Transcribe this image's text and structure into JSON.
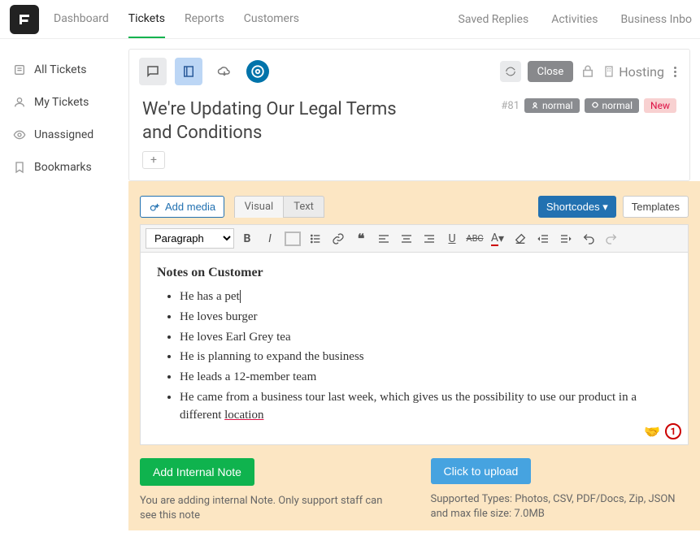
{
  "topnav": [
    "Dashboard",
    "Tickets",
    "Reports",
    "Customers"
  ],
  "topnav_active": 1,
  "rightnav": [
    "Saved Replies",
    "Activities",
    "Business Inbo"
  ],
  "sidebar": [
    {
      "label": "All Tickets",
      "icon": "list"
    },
    {
      "label": "My Tickets",
      "icon": "user"
    },
    {
      "label": "Unassigned",
      "icon": "eye"
    },
    {
      "label": "Bookmarks",
      "icon": "bookmark"
    }
  ],
  "panel": {
    "close_label": "Close",
    "hosting_label": "Hosting"
  },
  "ticket": {
    "title": "We're Updating Our Legal Terms and Conditions",
    "id": "#81",
    "badges": [
      {
        "label": "normal",
        "kind": "grey"
      },
      {
        "label": "normal",
        "kind": "grey"
      },
      {
        "label": "New",
        "kind": "red"
      }
    ]
  },
  "editor": {
    "add_media": "Add media",
    "tabs": {
      "visual": "Visual",
      "text": "Text"
    },
    "shortcodes_label": "Shortcodes",
    "templates_label": "Templates",
    "format_select": "Paragraph",
    "heading": "Notes on Customer",
    "bullets": [
      "He has a pet",
      "He loves burger",
      "He loves Earl Grey tea",
      "He is planning to expand the business",
      "He leads a 12-member team"
    ],
    "bullet_last_pre": "He came from a business tour last week, which gives us the possibility to use our product in a different ",
    "bullet_last_word": "location",
    "grammar_count": "1"
  },
  "actions": {
    "add_note": "Add Internal Note",
    "note_hint": "You are adding internal Note. Only support staff can see this note",
    "upload": "Click to upload",
    "upload_hint": "Supported Types: Photos, CSV, PDF/Docs, Zip, JSON and max file size: 7.0MB"
  }
}
